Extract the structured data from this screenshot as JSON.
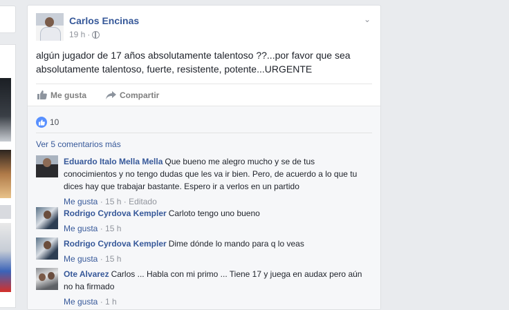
{
  "post": {
    "author": "Carlos Encinas",
    "time": "19 h",
    "text": "algún jugador de 17 años absolutamente talentoso ??...por favor que sea absolutamente talentoso, fuerte, resistente, potente...URGENTE",
    "like_label": "Me gusta",
    "share_label": "Compartir",
    "like_count": "10",
    "more_comments": "Ver 5 comentarios más"
  },
  "comments": [
    {
      "author": "Eduardo Italo Mella Mella",
      "text": "Que bueno me alegro mucho y se de tus conocimientos y no tengo dudas que les va ir bien. Pero, de acuerdo a lo que tu dices hay que trabajar bastante. Espero ir a verlos en un partido",
      "like": "Me gusta",
      "time": "15 h",
      "edited": "Editado"
    },
    {
      "author": "Rodrigo Cyrdova Kempler",
      "text": "Carloto tengo uno bueno",
      "like": "Me gusta",
      "time": "15 h"
    },
    {
      "author": "Rodrigo Cyrdova Kempler",
      "text": "Dime dónde lo mando para q lo veas",
      "like": "Me gusta",
      "time": "15 h"
    },
    {
      "author": "Ote Alvarez",
      "text": "Carlos ... Habla con mi primo ... Tiene 17 y juega en audax pero aún no ha firmado",
      "like": "Me gusta",
      "time": "1 h"
    }
  ],
  "colors": {
    "link": "#365899",
    "like_badge": "#5890ff",
    "meta": "#90949c"
  }
}
